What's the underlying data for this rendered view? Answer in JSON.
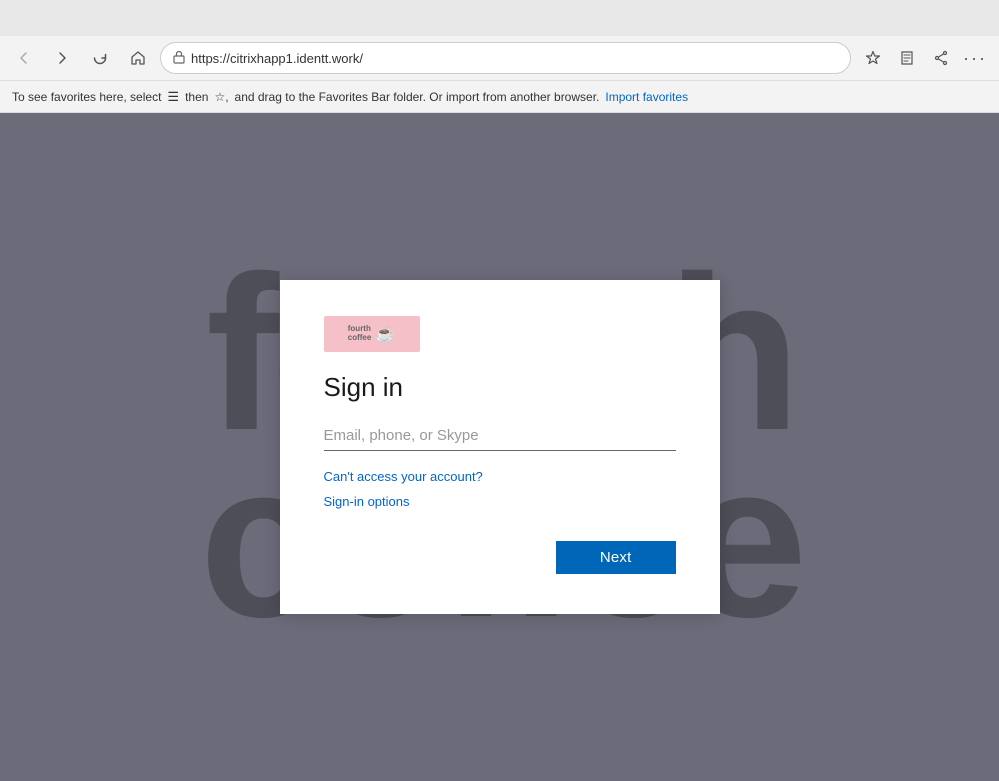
{
  "browser": {
    "url": "https://citrixhapp1.identt.work/",
    "back_tooltip": "Back",
    "forward_tooltip": "Forward",
    "refresh_tooltip": "Refresh",
    "home_tooltip": "Home"
  },
  "favorites_bar": {
    "message": "To see favorites here, select",
    "then_text": "then",
    "star_text": "★, and drag to the Favorites Bar folder. Or import from another browser.",
    "import_link": "Import favorites"
  },
  "background": {
    "text_line1": "fourth",
    "text_line2": "coffee"
  },
  "signin": {
    "title": "Sign in",
    "email_placeholder": "Email, phone, or Skype",
    "cant_access_label": "Can't access your account?",
    "signin_options_label": "Sign-in options",
    "next_button_label": "Next"
  }
}
